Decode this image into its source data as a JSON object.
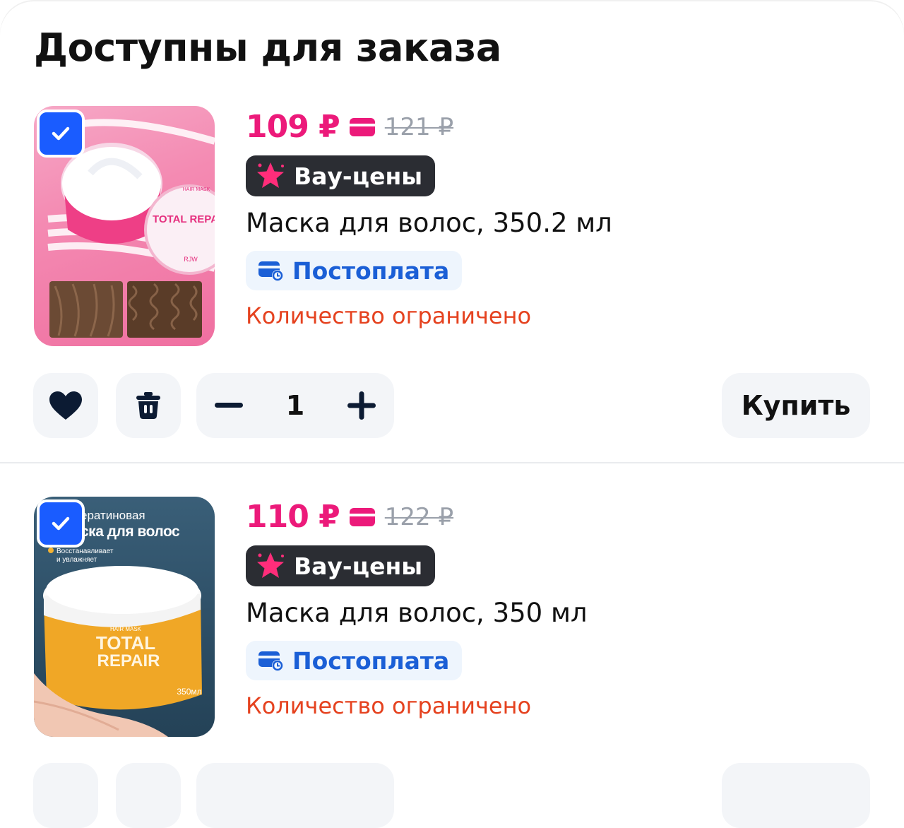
{
  "section_title": "Доступны для заказа",
  "colors": {
    "accent_price": "#ec1a7a",
    "checkbox": "#1a5cff",
    "limited": "#e5421f",
    "postpay": "#1b5fd6"
  },
  "items": [
    {
      "selected": true,
      "price_now": "109 ₽",
      "price_old": "121 ₽",
      "promo_badge": "Вау-цены",
      "name": "Маска для волос, 350.2 мл",
      "payment_badge": "Постоплата",
      "stock_note": "Количество ограничено",
      "image": {
        "label_brand": "TOTAL REPAIR",
        "label_small": "HAIR MASK",
        "label_maker": "RJW"
      },
      "quantity": "1",
      "buy_label": "Купить",
      "icons": [
        "heart-icon",
        "trash-icon",
        "minus-icon",
        "plus-icon"
      ]
    },
    {
      "selected": true,
      "price_now": "110 ₽",
      "price_old": "122 ₽",
      "promo_badge": "Вау-цены",
      "name": "Маска для волос, 350 мл",
      "payment_badge": "Постоплата",
      "stock_note": "Количество ограничено",
      "image": {
        "headline_1": "ератиновая",
        "headline_2": "ска для волос",
        "subline_1": "Восстанавливает",
        "subline_2": "и увлажняет",
        "label_small": "HAIR MASK",
        "label_brand_1": "TOTAL",
        "label_brand_2": "REPAIR",
        "volume": "350мл"
      }
    }
  ]
}
